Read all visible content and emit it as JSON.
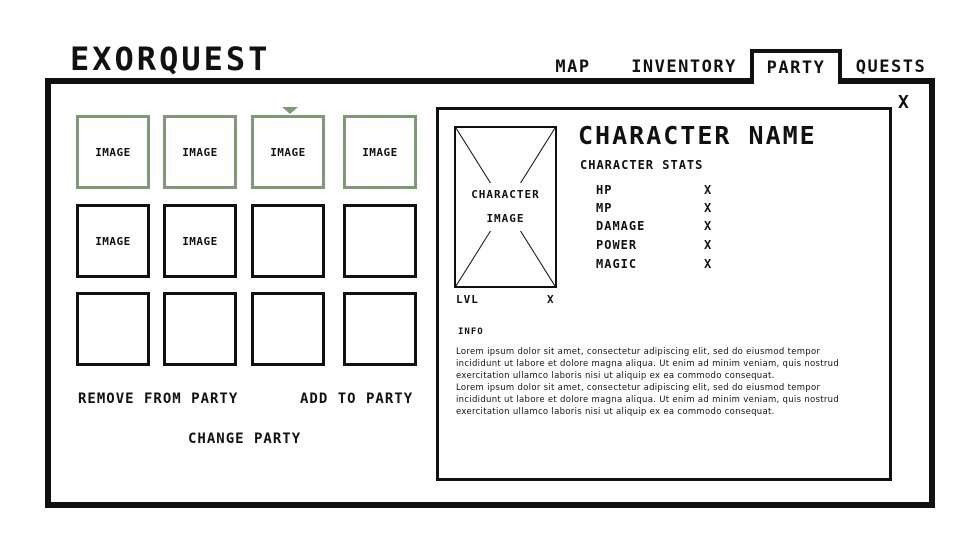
{
  "app": {
    "title": "EXORQUEST",
    "close_label": "X"
  },
  "tabs": [
    {
      "label": "MAP"
    },
    {
      "label": "INVENTORY"
    },
    {
      "label": "PARTY",
      "active": true
    },
    {
      "label": "QUESTS"
    }
  ],
  "party_grid": {
    "slots": [
      {
        "label": "IMAGE",
        "in_party": true
      },
      {
        "label": "IMAGE",
        "in_party": true
      },
      {
        "label": "IMAGE",
        "in_party": true,
        "selected": true
      },
      {
        "label": "IMAGE",
        "in_party": true
      },
      {
        "label": "IMAGE",
        "in_party": false
      },
      {
        "label": "IMAGE",
        "in_party": false
      },
      {
        "label": "",
        "in_party": false
      },
      {
        "label": "",
        "in_party": false
      },
      {
        "label": "",
        "in_party": false
      },
      {
        "label": "",
        "in_party": false
      },
      {
        "label": "",
        "in_party": false
      },
      {
        "label": "",
        "in_party": false
      }
    ],
    "remove_label": "REMOVE FROM PARTY",
    "add_label": "ADD TO PARTY",
    "change_label": "CHANGE PARTY"
  },
  "character": {
    "image_label_line1": "CHARACTER",
    "image_label_line2": "IMAGE",
    "level_label": "LVL",
    "level_value": "X",
    "name": "CHARACTER NAME",
    "stats_title": "CHARACTER STATS",
    "stats": [
      {
        "label": "HP",
        "value": "X"
      },
      {
        "label": "MP",
        "value": "X"
      },
      {
        "label": "DAMAGE",
        "value": "X"
      },
      {
        "label": "POWER",
        "value": "X"
      },
      {
        "label": "MAGIC",
        "value": "X"
      }
    ],
    "info_title": "INFO",
    "info_text": "Lorem ipsum dolor sit amet, consectetur adipiscing elit, sed do eiusmod tempor\nincididunt ut labore et dolore magna aliqua. Ut enim ad minim veniam, quis nostrud\nexercitation ullamco laboris nisi ut aliquip ex ea commodo consequat.\nLorem ipsum dolor sit amet, consectetur adipiscing elit, sed do eiusmod tempor\nincididunt ut labore et dolore magna aliqua. Ut enim ad minim veniam, quis nostrud\nexercitation ullamco laboris nisi ut aliquip ex ea commodo consequat."
  },
  "colors": {
    "accent": "#7d9a74",
    "ink": "#111111",
    "background": "#ffffff"
  }
}
